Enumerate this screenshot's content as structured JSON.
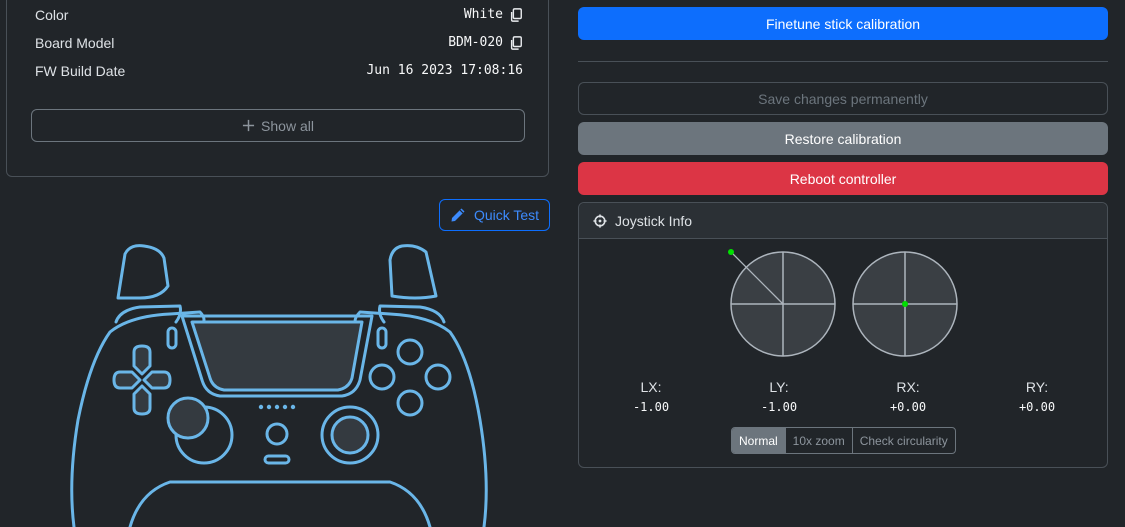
{
  "info": {
    "rows": [
      {
        "label": "Color",
        "value": "White"
      },
      {
        "label": "Board Model",
        "value": "BDM-020"
      },
      {
        "label": "FW Build Date",
        "value": "Jun 16 2023 17:08:16"
      }
    ],
    "show_all_label": "Show all"
  },
  "quick_test_label": "Quick Test",
  "actions": {
    "finetune_label": "Finetune stick calibration",
    "save_label": "Save changes permanently",
    "restore_label": "Restore calibration",
    "reboot_label": "Reboot controller"
  },
  "joystick": {
    "title": "Joystick Info",
    "axes": [
      {
        "label": "LX:",
        "value": "-1.00"
      },
      {
        "label": "LY:",
        "value": "-1.00"
      },
      {
        "label": "RX:",
        "value": "+0.00"
      },
      {
        "label": "RY:",
        "value": "+0.00"
      }
    ],
    "modes": [
      "Normal",
      "10x zoom",
      "Check circularity"
    ],
    "active_mode": "Normal",
    "dot_color": "#00e000"
  },
  "colors": {
    "primary": "#0d6efd",
    "secondary": "#6c757d",
    "danger": "#dc3545",
    "controller_outline": "#6ab6e8"
  }
}
